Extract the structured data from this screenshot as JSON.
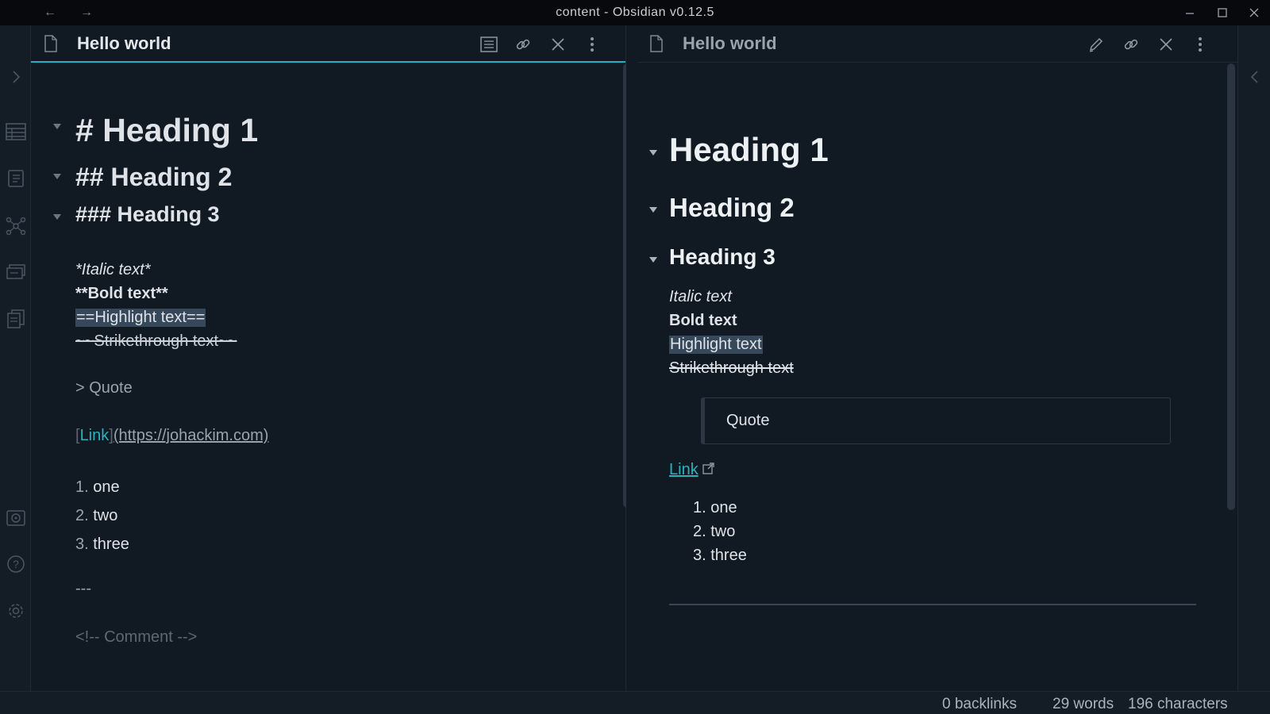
{
  "window": {
    "title": "content - Obsidian v0.12.5",
    "back_glyph": "←",
    "forward_glyph": "→"
  },
  "ribbon": {
    "icons": [
      "collapse-left-sidebar-icon",
      "table-icon",
      "daily-notes-icon",
      "graph-view-icon",
      "slides-icon",
      "templates-icon",
      "vault-icon",
      "help-icon",
      "settings-icon"
    ]
  },
  "left_pane": {
    "title": "Hello world",
    "actions": [
      "reading-view-icon",
      "link-icon",
      "close-icon",
      "more-options-icon"
    ],
    "source": {
      "h1": "# Heading 1",
      "h2": "## Heading 2",
      "h3": "### Heading 3",
      "italic": "*Italic text*",
      "bold": "**Bold text**",
      "highlight": "==Highlight text==",
      "strike": "~~Strikethrough text~~",
      "quote": "> Quote",
      "link_open": "[",
      "link_text": "Link",
      "link_close": "]",
      "link_url": "(https://johackim.com)",
      "list": [
        {
          "num": "1.",
          "text": "one"
        },
        {
          "num": "2.",
          "text": "two"
        },
        {
          "num": "3.",
          "text": "three"
        }
      ],
      "hr": "---",
      "comment": "<!-- Comment -->"
    }
  },
  "right_pane": {
    "title": "Hello world",
    "actions": [
      "edit-icon",
      "link-icon",
      "close-icon",
      "more-options-icon"
    ],
    "preview": {
      "h1": "Heading 1",
      "h2": "Heading 2",
      "h3": "Heading 3",
      "italic": "Italic text",
      "bold": "Bold text",
      "highlight": "Highlight text",
      "strike": "Strikethrough text",
      "quote": "Quote",
      "link": "Link",
      "list": [
        {
          "num": "1.",
          "text": "one"
        },
        {
          "num": "2.",
          "text": "two"
        },
        {
          "num": "3.",
          "text": "three"
        }
      ]
    }
  },
  "status": {
    "backlinks": "0 backlinks",
    "words": "29 words",
    "characters": "196 characters"
  },
  "colors": {
    "accent": "#1fb3c2",
    "link": "#27b3bf",
    "background": "#111922",
    "titlebar": "#07090d"
  }
}
